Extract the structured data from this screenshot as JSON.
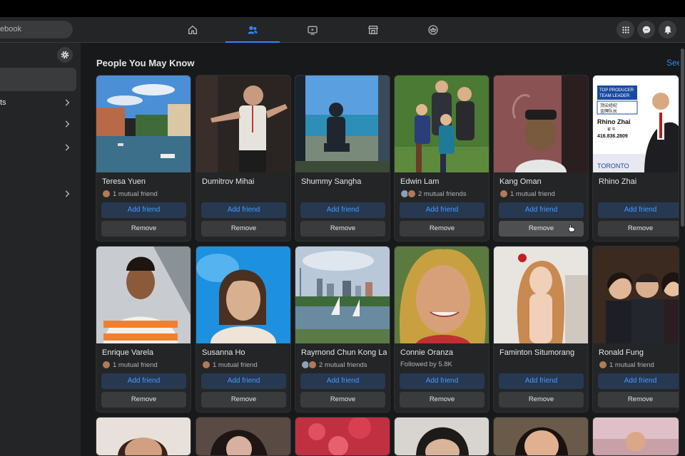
{
  "search": {
    "text": "ebook"
  },
  "nav": {
    "tabs": [
      {
        "name": "home",
        "active": false
      },
      {
        "name": "friends",
        "active": true
      },
      {
        "name": "watch",
        "active": false
      },
      {
        "name": "marketplace",
        "active": false
      },
      {
        "name": "groups",
        "active": false
      }
    ]
  },
  "sidebar": {
    "items": [
      {
        "label": ""
      },
      {
        "label": "ts"
      },
      {
        "label": ""
      },
      {
        "label": ""
      },
      {
        "label": ""
      }
    ]
  },
  "main": {
    "title": "People You May Know",
    "see_all": "See"
  },
  "actions": {
    "add_label": "Add friend",
    "remove_label": "Remove"
  },
  "people": [
    {
      "name": "Teresa Yuen",
      "sub": "1 mutual friend"
    },
    {
      "name": "Dumitrov Mihai",
      "sub": ""
    },
    {
      "name": "Shummy Sangha",
      "sub": ""
    },
    {
      "name": "Edwin Lam",
      "sub": "2 mutual friends"
    },
    {
      "name": "Kang Oman",
      "sub": "1 mutual friend"
    },
    {
      "name": "Rhino Zhai",
      "sub": ""
    },
    {
      "name": "Enrique Varela",
      "sub": "1 mutual friend"
    },
    {
      "name": "Susanna Ho",
      "sub": "1 mutual friend"
    },
    {
      "name": "Raymond Chun Kong Lai",
      "sub": "2 mutual friends"
    },
    {
      "name": "Connie Oranza",
      "sub": "Followed by 5.8K"
    },
    {
      "name": "Faminton Situmorang",
      "sub": ""
    },
    {
      "name": "Ronald Fung",
      "sub": "1 mutual friend"
    }
  ],
  "photo_text": {
    "rhino_sign_line1": "TOP PRODUCER",
    "rhino_sign_line2": "TEAM LEADER",
    "rhino_sign_cn1": "顶尖经纪",
    "rhino_sign_cn2": "金牌队长",
    "rhino_sign_name": "Rhino Zhai",
    "rhino_sign_cn3": "翟 牛",
    "rhino_sign_phone": "416.836.2809",
    "rhino_sign_city": "TORONTO"
  },
  "colors": {
    "accent": "#2d88ff",
    "background": "#18191a",
    "card": "#242526"
  }
}
